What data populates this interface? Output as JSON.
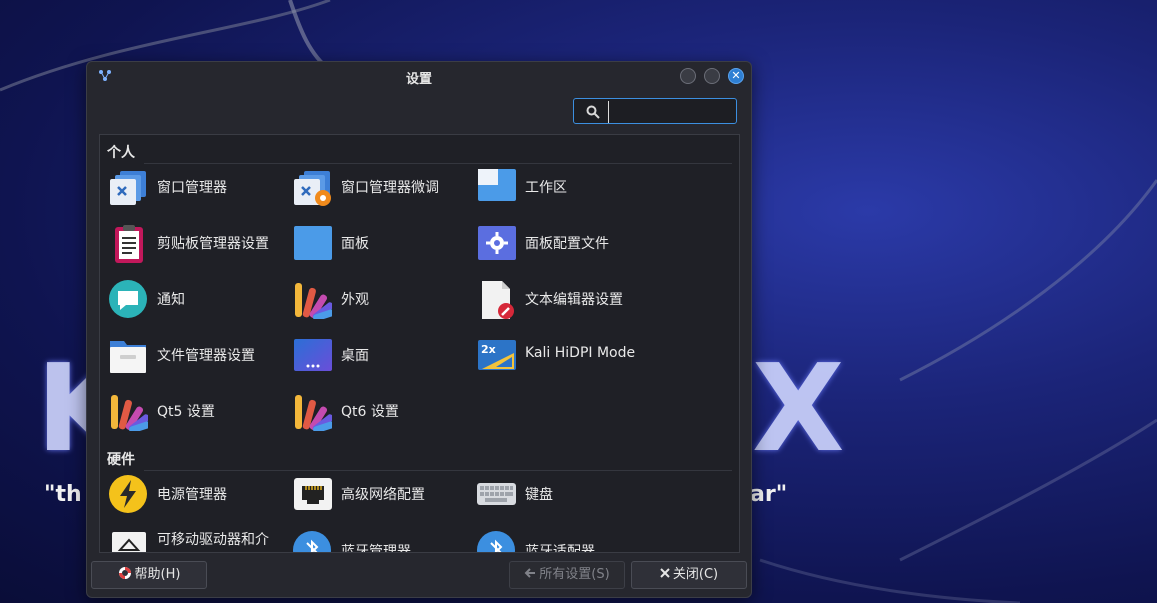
{
  "wallpaper": {
    "brand_letters_left": "K",
    "brand_letters_right": "X",
    "quote_left": "\"th",
    "quote_right": "ar\""
  },
  "dialog": {
    "title": "设置",
    "close_glyph": "✕"
  },
  "search": {
    "value": ""
  },
  "sections": {
    "personal": "个人",
    "hardware": "硬件"
  },
  "items": {
    "window_manager": "窗口管理器",
    "window_manager_tweaks": "窗口管理器微调",
    "workspaces": "工作区",
    "clipboard_manager": "剪贴板管理器设置",
    "panel": "面板",
    "panel_profiles": "面板配置文件",
    "notifications": "通知",
    "appearance": "外观",
    "text_editor": "文本编辑器设置",
    "file_manager": "文件管理器设置",
    "desktop": "桌面",
    "kali_hidpi": "Kali HiDPI Mode",
    "qt5": "Qt5 设置",
    "qt6": "Qt6 设置",
    "power_manager": "电源管理器",
    "advanced_network": "高级网络配置",
    "keyboard": "键盘",
    "removable_drives": "可移动驱动器和介",
    "bluetooth_manager": "蓝牙管理器",
    "bluetooth_adapters": "蓝牙适配器"
  },
  "buttons": {
    "help": "帮助(H)",
    "all_settings": "所有设置(S)",
    "close": "关闭(C)"
  },
  "colors": {
    "accent": "#3c8fe0",
    "highlight_ring": "#d01e1e",
    "dialog_bg": "#26272e"
  }
}
